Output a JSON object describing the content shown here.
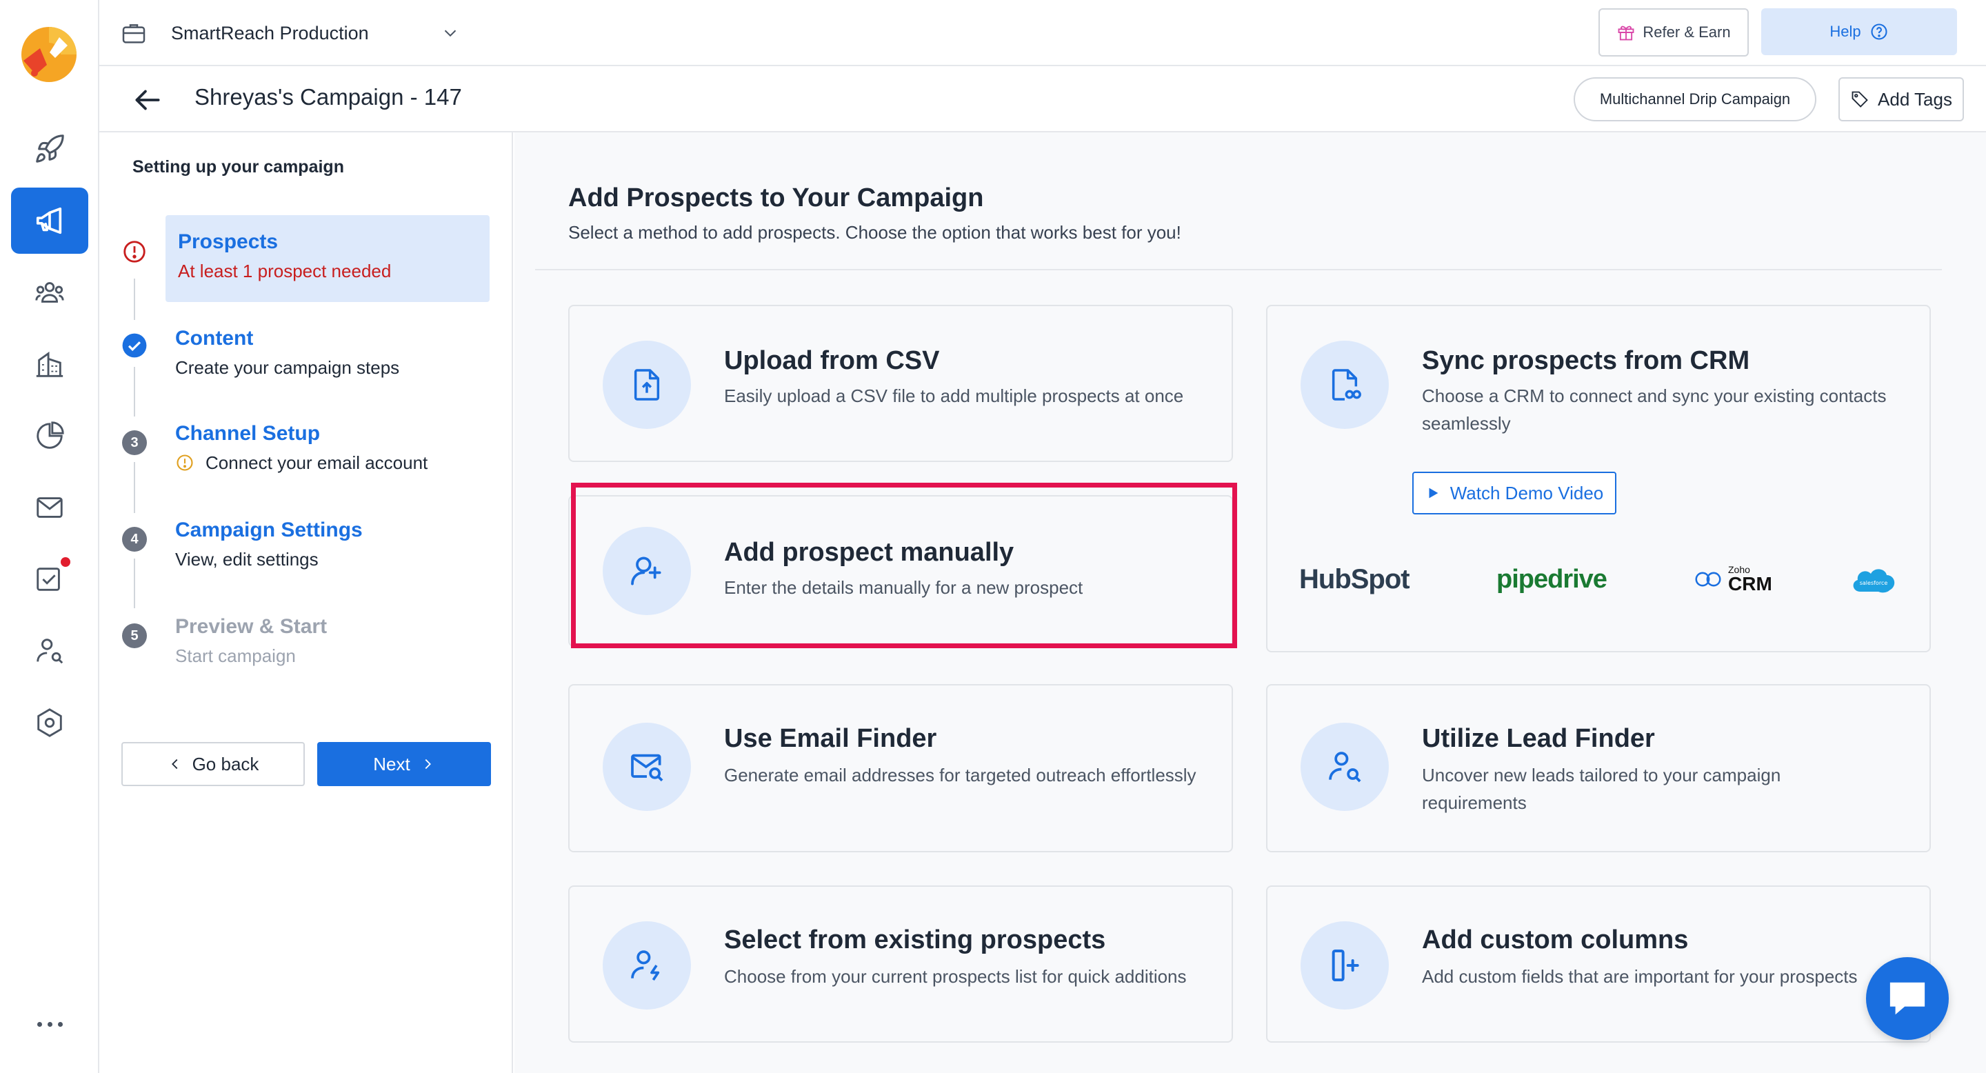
{
  "colors": {
    "brand": "#1a6fe0",
    "error": "#c81e1e",
    "highlight": "#e3124f",
    "icon_bg": "#dde9fb"
  },
  "rail": {
    "items": [
      {
        "name": "rocket-icon",
        "active": false
      },
      {
        "name": "megaphone-icon",
        "active": true
      },
      {
        "name": "users-icon",
        "active": false
      },
      {
        "name": "building-icon",
        "active": false
      },
      {
        "name": "pie-chart-icon",
        "active": false
      },
      {
        "name": "mail-icon",
        "active": false
      },
      {
        "name": "task-check-icon",
        "active": false,
        "badge": true
      },
      {
        "name": "prospect-search-icon",
        "active": false
      },
      {
        "name": "settings-hexagon-icon",
        "active": false
      }
    ]
  },
  "topbar": {
    "workspace": "SmartReach Production",
    "refer_label": "Refer & Earn",
    "help_label": "Help"
  },
  "campaign": {
    "title": "Shreyas's Campaign - 147",
    "type_label": "Multichannel Drip Campaign",
    "add_tags_label": "Add Tags"
  },
  "steps": {
    "heading": "Setting up your campaign",
    "items": [
      {
        "title": "Prospects",
        "subtitle": "At least 1 prospect needed",
        "state": "error"
      },
      {
        "title": "Content",
        "subtitle": "Create your campaign steps",
        "state": "done"
      },
      {
        "number": "3",
        "title": "Channel Setup",
        "subtitle": "Connect your email account",
        "state": "warning"
      },
      {
        "number": "4",
        "title": "Campaign Settings",
        "subtitle": "View, edit settings",
        "state": "pending"
      },
      {
        "number": "5",
        "title": "Preview & Start",
        "subtitle": "Start campaign",
        "state": "disabled"
      }
    ],
    "back_label": "Go back",
    "next_label": "Next"
  },
  "main": {
    "title": "Add Prospects to Your Campaign",
    "subtitle": "Select a method to add prospects. Choose the option that works best for you!",
    "cards": {
      "csv": {
        "title": "Upload from CSV",
        "desc": "Easily upload a CSV file to add multiple prospects at once",
        "icon": "upload-file-icon"
      },
      "crm": {
        "title": "Sync prospects from CRM",
        "desc": "Choose a CRM to connect and sync your existing contacts seamlessly",
        "icon": "crm-file-icon",
        "demo_label": "Watch Demo Video",
        "logos": {
          "hubspot": "HubSpot",
          "pipedrive": "pipedrive",
          "zoho_small": "Zoho",
          "zoho_big": "CRM",
          "salesforce": "salesforce"
        }
      },
      "manual": {
        "title": "Add prospect manually",
        "desc": "Enter the details manually for a new prospect",
        "icon": "user-plus-icon",
        "highlighted": true
      },
      "email_finder": {
        "title": "Use Email Finder",
        "desc": "Generate email addresses for targeted outreach effortlessly",
        "icon": "mail-search-icon"
      },
      "lead_finder": {
        "title": "Utilize Lead Finder",
        "desc": "Uncover new leads tailored to your campaign requirements",
        "icon": "user-search-icon"
      },
      "existing": {
        "title": "Select from existing prospects",
        "desc": "Choose from your current prospects list for quick additions",
        "icon": "user-bolt-icon"
      },
      "custom_columns": {
        "title": "Add custom columns",
        "desc": "Add custom fields that are important for your prospects",
        "icon": "column-plus-icon"
      }
    }
  }
}
